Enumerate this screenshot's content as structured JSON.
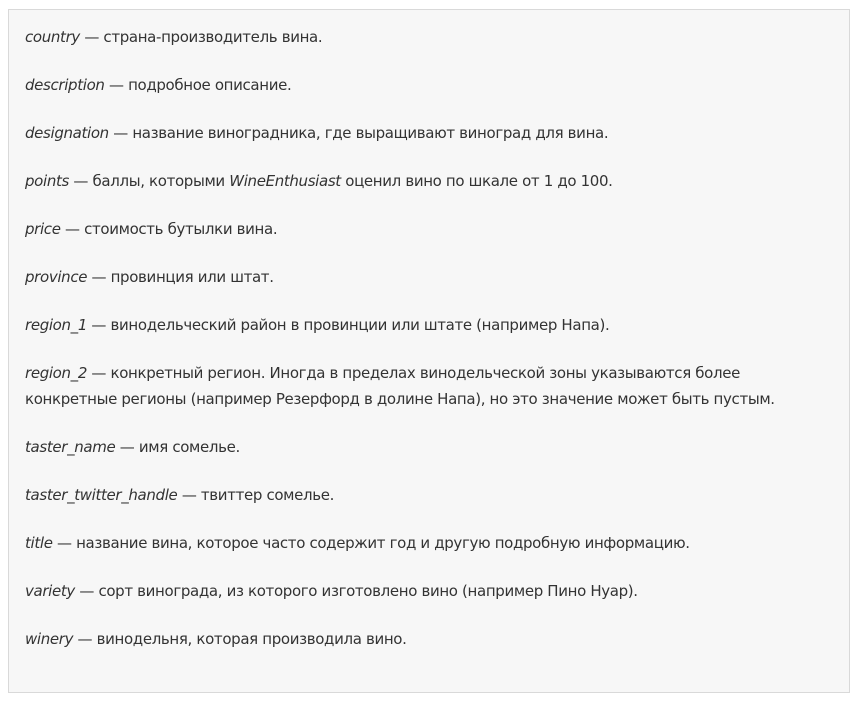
{
  "dash": " — ",
  "entries": [
    {
      "term": "country",
      "desc": "страна-производитель вина."
    },
    {
      "term": "description",
      "desc": "подробное описание."
    },
    {
      "term": "designation",
      "desc": "название виноградника, где выращивают виноград для вина."
    },
    {
      "term": "points",
      "desc_before": "баллы, которыми ",
      "desc_em": "WineEnthusiast",
      "desc_after": " оценил вино по шкале от 1 до 100."
    },
    {
      "term": "price",
      "desc": "стоимость бутылки вина."
    },
    {
      "term": "province",
      "desc": "провинция или штат."
    },
    {
      "term": "region_1",
      "desc": "винодельческий район в провинции или штате (например Напа)."
    },
    {
      "term": "region_2",
      "desc": "конкретный регион. Иногда в пределах винодельческой зоны указываются более конкретные регионы (например Резерфорд в долине Напа), но это значение может быть пустым."
    },
    {
      "term": "taster_name",
      "desc": "имя сомелье."
    },
    {
      "term": "taster_twitter_handle",
      "desc": "твиттер сомелье."
    },
    {
      "term": "title",
      "desc": "название вина, которое часто содержит год и другую подробную информацию."
    },
    {
      "term": "variety",
      "desc": "сорт винограда, из которого изготовлено вино (например Пино Нуар)."
    },
    {
      "term": "winery",
      "desc": "винодельня, которая производила вино."
    }
  ]
}
